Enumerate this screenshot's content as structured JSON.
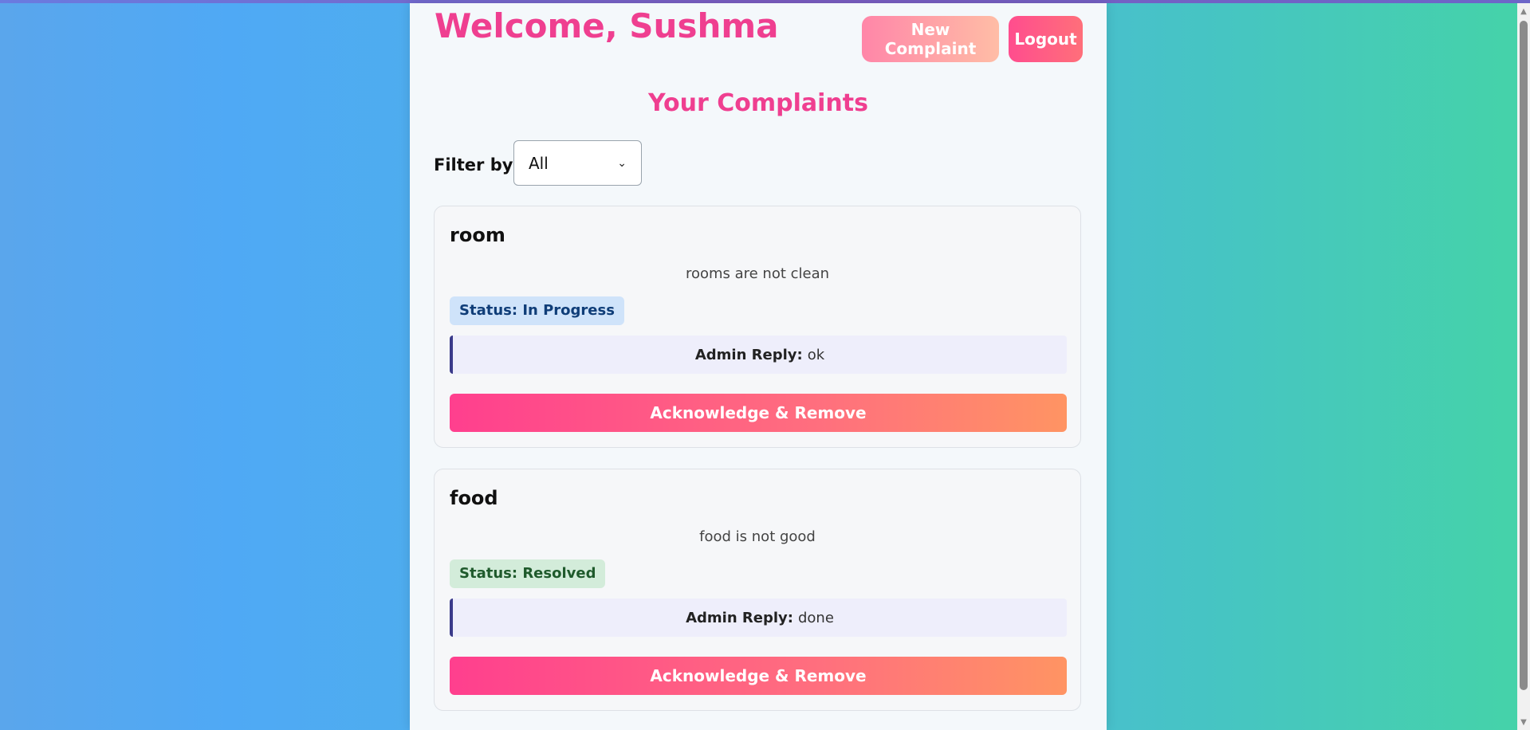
{
  "header": {
    "welcome": "Welcome, Sushma",
    "new_complaint_label": "New Complaint",
    "logout_label": "Logout"
  },
  "section_title": "Your Complaints",
  "filter": {
    "label": "Filter by:",
    "selected": "All"
  },
  "complaints": [
    {
      "title": "room",
      "description": "rooms are not clean",
      "status": "Status: In Progress",
      "reply_label": "Admin Reply:",
      "reply": "ok",
      "action_label": "Acknowledge & Remove"
    },
    {
      "title": "food",
      "description": "food is not good",
      "status": "Status: Resolved",
      "reply_label": "Admin Reply:",
      "reply": "done",
      "action_label": "Acknowledge & Remove"
    }
  ],
  "colors": {
    "accent_pink": "#ef3f90",
    "status_in_progress_bg": "#cfe3fa",
    "status_resolved_bg": "#d3ecda"
  }
}
